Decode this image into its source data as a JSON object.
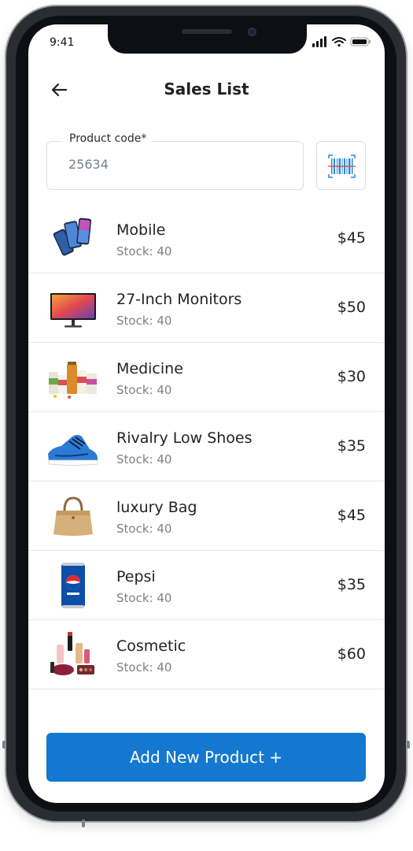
{
  "status_bar": {
    "time": "9:41"
  },
  "header": {
    "title": "Sales List"
  },
  "product_code": {
    "label": "Product code*",
    "value": "25634"
  },
  "products": [
    {
      "name": "Mobile",
      "stock": "Stock: 40",
      "price": "$45",
      "icon": "mobile-phones-image"
    },
    {
      "name": "27-Inch Monitors",
      "stock": "Stock: 40",
      "price": "$50",
      "icon": "monitor-image"
    },
    {
      "name": "Medicine",
      "stock": "Stock: 40",
      "price": "$30",
      "icon": "medicine-bottles-image"
    },
    {
      "name": "Rivalry Low Shoes",
      "stock": "Stock: 40",
      "price": "$35",
      "icon": "sneaker-image"
    },
    {
      "name": "luxury Bag",
      "stock": "Stock: 40",
      "price": "$45",
      "icon": "handbag-image"
    },
    {
      "name": "Pepsi",
      "stock": "Stock: 40",
      "price": "$35",
      "icon": "pepsi-can-image"
    },
    {
      "name": "Cosmetic",
      "stock": "Stock: 40",
      "price": "$60",
      "icon": "cosmetics-image"
    }
  ],
  "footer": {
    "add_button_label": "Add New Product +"
  },
  "colors": {
    "primary": "#1478d0",
    "text": "#222222",
    "muted": "#7d8088",
    "divider": "#e6e7ea"
  }
}
